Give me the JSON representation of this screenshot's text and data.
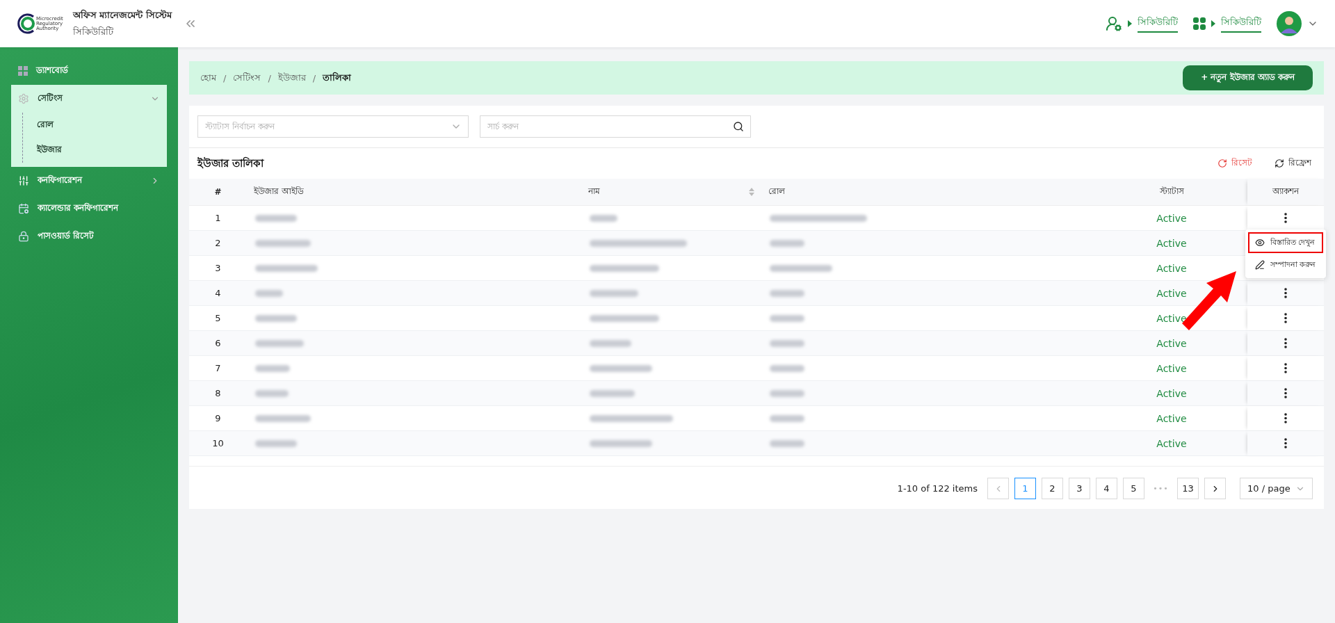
{
  "header": {
    "app_title": "অফিস ম্যানেজমেন্ট সিস্টেম",
    "app_subtitle": "সিকিউরিটি",
    "logo_text": [
      "Microcredit",
      "Regulatory",
      "Authority"
    ],
    "switch_links": [
      {
        "kind": "user",
        "label": "সিকিউরিটি"
      },
      {
        "kind": "apps",
        "label": "সিকিউরিটি"
      }
    ]
  },
  "sidebar": {
    "items": [
      {
        "kind": "dashboard",
        "label": "ড্যাশবোর্ড",
        "expanded": false
      },
      {
        "kind": "settings",
        "label": "সেটিংস",
        "expanded": true,
        "children": [
          {
            "label": "রোল"
          },
          {
            "label": "ইউজার"
          }
        ]
      },
      {
        "kind": "config",
        "label": "কনফিগারেশন",
        "expanded": false,
        "has_children": true
      },
      {
        "kind": "calendar",
        "label": "ক্যালেন্ডার কনফিগারেশন",
        "expanded": false
      },
      {
        "kind": "password",
        "label": "পাসওয়ার্ড রিসেট",
        "expanded": false
      }
    ]
  },
  "breadcrumb": [
    "হোম",
    "সেটিংস",
    "ইউজার",
    "তালিকা"
  ],
  "breadcrumb_separator": "/",
  "add_button": "+ নতুন ইউজার অ্যাড করুন",
  "filters": {
    "status_placeholder": "স্ট্যাটাস নির্বাচন করুন",
    "search_placeholder": "সার্চ করুন"
  },
  "table": {
    "title": "ইউজার তালিকা",
    "reset": "রিসেট",
    "refresh": "রিফ্রেশ",
    "columns": [
      "#",
      "ইউজার আইডি",
      "নাম",
      "রোল",
      "স্ট্যাটাস",
      "অ্যাকশন"
    ],
    "rows": [
      {
        "index": "1",
        "status": "Active"
      },
      {
        "index": "2",
        "status": "Active"
      },
      {
        "index": "3",
        "status": "Active"
      },
      {
        "index": "4",
        "status": "Active"
      },
      {
        "index": "5",
        "status": "Active"
      },
      {
        "index": "6",
        "status": "Active"
      },
      {
        "index": "7",
        "status": "Active"
      },
      {
        "index": "8",
        "status": "Active"
      },
      {
        "index": "9",
        "status": "Active"
      },
      {
        "index": "10",
        "status": "Active"
      }
    ]
  },
  "action_menu": [
    {
      "kind": "view",
      "label": "বিস্তারিত দেখুন",
      "highlighted": true
    },
    {
      "kind": "edit",
      "label": "সম্পাদনা করুন",
      "highlighted": false
    }
  ],
  "pagination": {
    "summary": "1-10 of 122 items",
    "pages": [
      {
        "label": "1",
        "selected": true
      },
      {
        "label": "2",
        "selected": false
      },
      {
        "label": "3",
        "selected": false
      },
      {
        "label": "4",
        "selected": false
      },
      {
        "label": "5",
        "selected": false
      },
      {
        "label": "•••",
        "selected": false
      },
      {
        "label": "13",
        "selected": false
      }
    ],
    "page_size": "10 / page"
  }
}
